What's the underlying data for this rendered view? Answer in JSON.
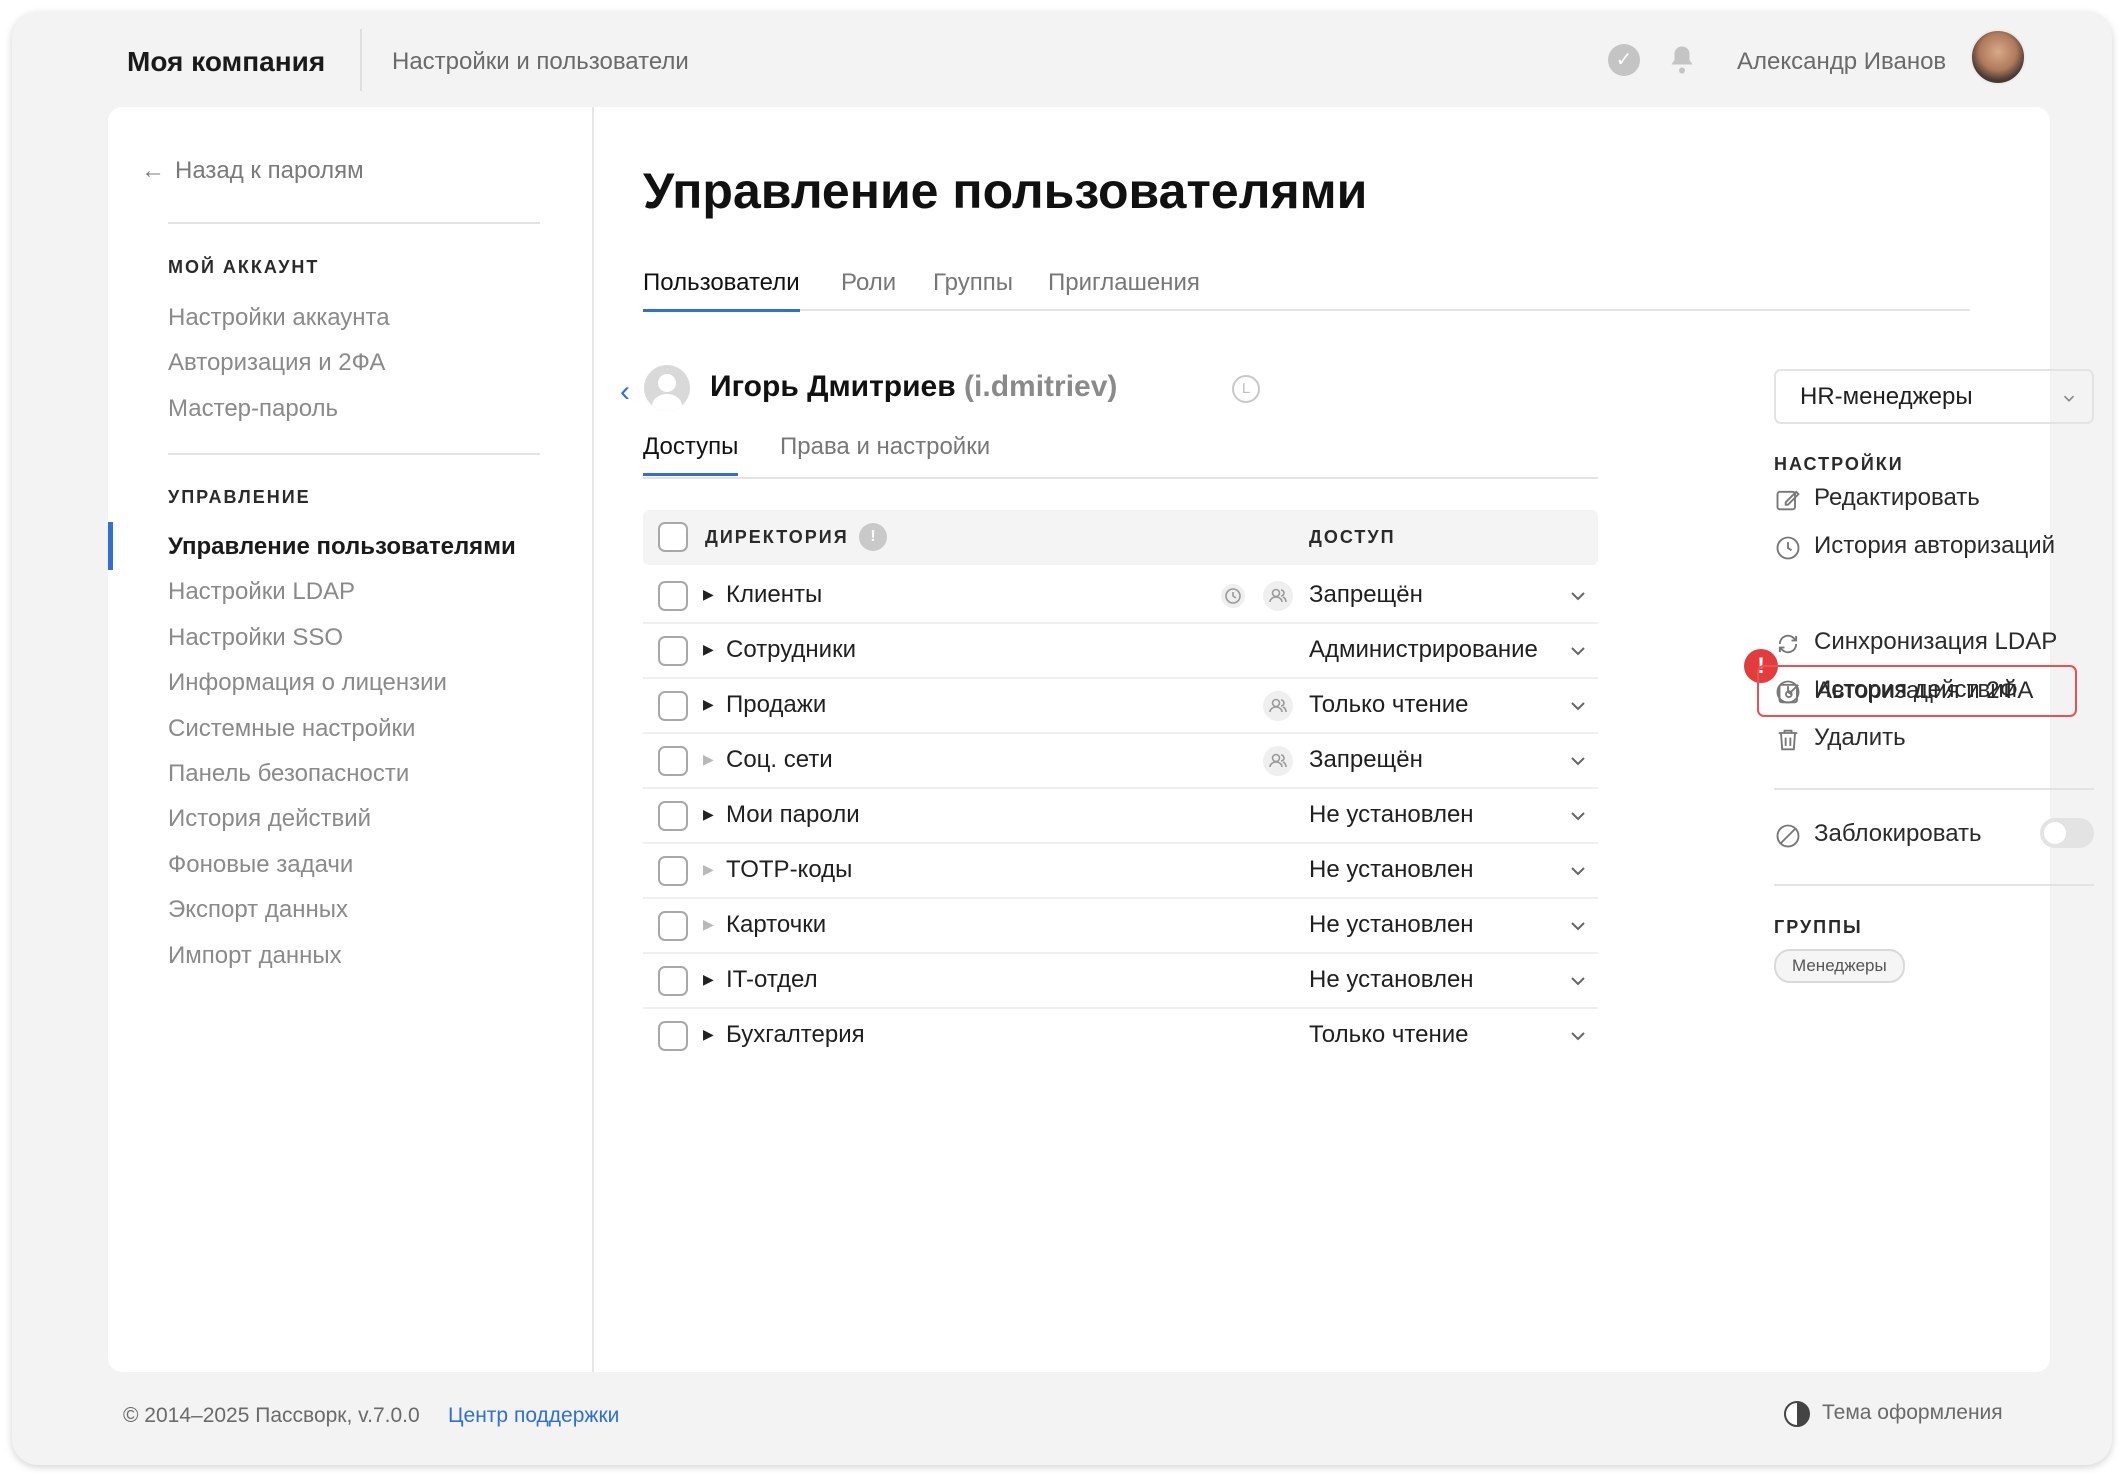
{
  "header": {
    "company": "Моя компания",
    "section": "Настройки и пользователи",
    "user_name": "Александр Иванов"
  },
  "sidebar": {
    "back_label": "Назад к паролям",
    "account_title": "МОЙ АККАУНТ",
    "account_items": [
      "Настройки аккаунта",
      "Авторизация и 2ФА",
      "Мастер-пароль"
    ],
    "manage_title": "УПРАВЛЕНИЕ",
    "manage_items": [
      "Управление пользователями",
      "Настройки LDAP",
      "Настройки SSO",
      "Информация о лицензии",
      "Системные настройки",
      "Панель безопасности",
      "История действий",
      "Фоновые задачи",
      "Экспорт данных",
      "Импорт данных"
    ]
  },
  "main": {
    "title": "Управление пользователями",
    "tabs": [
      "Пользователи",
      "Роли",
      "Группы",
      "Приглашения"
    ],
    "user": {
      "name": "Игорь Дмитриев",
      "login": "(i.dmitriev)",
      "badge": "L"
    },
    "subtabs": [
      "Доступы",
      "Права и настройки"
    ],
    "table": {
      "col_directory": "ДИРЕКТОРИЯ",
      "col_access": "ДОСТУП",
      "info_icon": "!",
      "rows": [
        {
          "name": "Клиенты",
          "access": "Запрещён"
        },
        {
          "name": "Сотрудники",
          "access": "Администрирование"
        },
        {
          "name": "Продажи",
          "access": "Только чтение"
        },
        {
          "name": "Соц. сети",
          "access": "Запрещён"
        },
        {
          "name": "Мои пароли",
          "access": "Не установлен"
        },
        {
          "name": "TOTP-коды",
          "access": "Не установлен"
        },
        {
          "name": "Карточки",
          "access": "Не установлен"
        },
        {
          "name": "IT-отдел",
          "access": "Не установлен"
        },
        {
          "name": "Бухгалтерия",
          "access": "Только чтение"
        }
      ]
    }
  },
  "right_panel": {
    "group_select": "HR-менеджеры",
    "settings_title": "НАСТРОЙКИ",
    "actions": [
      "Редактировать",
      "История авторизаций",
      "Авторизация и 2ФА",
      "Синхронизация LDAP",
      "История действий",
      "Удалить"
    ],
    "alert_mark": "!",
    "block_label": "Заблокировать",
    "block_enabled": false,
    "groups_title": "ГРУППЫ",
    "groups": [
      "Менеджеры"
    ]
  },
  "footer": {
    "copyright": "© 2014–2025 Пассворк, v.7.0.0",
    "support": "Центр поддержки",
    "theme": "Тема оформления"
  },
  "colors": {
    "accent": "#2f6fd6",
    "alert": "#e23c3c",
    "highlight_border": "#e95252"
  }
}
